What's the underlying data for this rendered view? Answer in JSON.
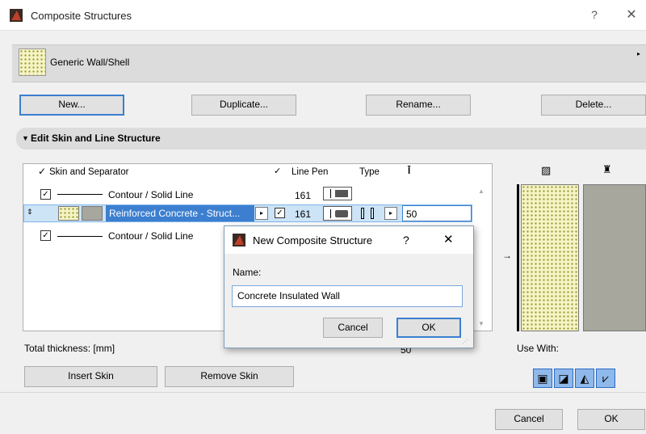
{
  "window": {
    "title": "Composite Structures",
    "help": "?",
    "close": "✕"
  },
  "header": {
    "structure_name": "Generic Wall/Shell",
    "menu_arrow": "▸"
  },
  "toolbar": {
    "new": "New...",
    "duplicate": "Duplicate...",
    "rename": "Rename...",
    "delete": "Delete..."
  },
  "section": {
    "arrow": "▼",
    "title": "Edit Skin and Line Structure"
  },
  "table": {
    "headers": {
      "skin": "Skin and Separator",
      "line_pen": "Line Pen",
      "type": "Type",
      "thickness_icon": "Ī"
    },
    "rows": [
      {
        "name": "Contour / Solid Line",
        "pen": "161"
      },
      {
        "name": "Reinforced Concrete - Struct...",
        "pen": "161",
        "thickness": "50"
      },
      {
        "name": "Contour / Solid Line"
      }
    ],
    "checkmark": "✓"
  },
  "total_thickness": {
    "label": "Total thickness: [mm]",
    "value": "50"
  },
  "skin_buttons": {
    "insert": "Insert Skin",
    "remove": "Remove Skin"
  },
  "modal": {
    "title": "New Composite Structure",
    "help": "?",
    "close": "✕",
    "name_label": "Name:",
    "name_value": "Concrete Insulated Wall",
    "cancel": "Cancel",
    "ok": "OK"
  },
  "preview": {
    "use_with": "Use With:"
  },
  "footer": {
    "cancel": "Cancel",
    "ok": "OK"
  },
  "colors": {
    "accent": "#3c7fd0",
    "selection": "#cde4f7",
    "concrete_fill": "#f6f4c4",
    "gray_fill": "#a7a79e"
  }
}
